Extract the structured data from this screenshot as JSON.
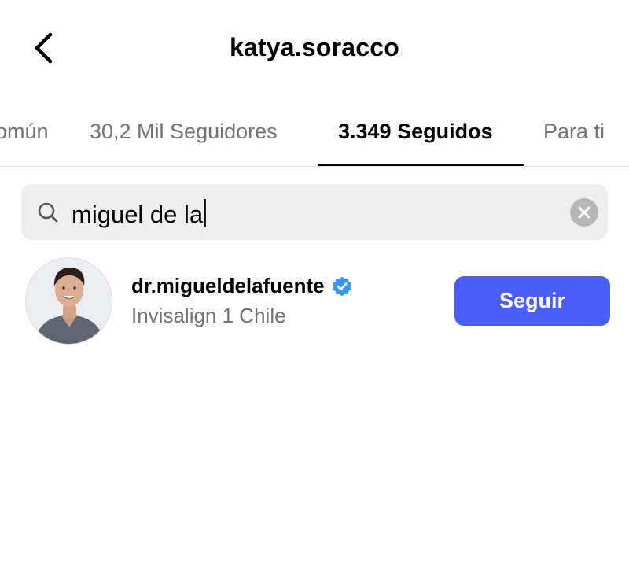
{
  "header": {
    "title": "katya.soracco",
    "back_icon": "chevron-left-icon"
  },
  "tabs": [
    {
      "label": "omún",
      "active": false
    },
    {
      "label": "30,2 Mil Seguidores",
      "active": false
    },
    {
      "label": "3.349 Seguidos",
      "active": true
    },
    {
      "label": "Para ti",
      "active": false
    }
  ],
  "search": {
    "value": "miguel de la",
    "search_icon": "search-icon",
    "clear_icon": "clear-icon"
  },
  "results": [
    {
      "username": "dr.migueldelafuente",
      "verified": true,
      "subtitle": "Invisalign 1 Chile",
      "button_label": "Seguir"
    }
  ],
  "colors": {
    "accent": "#4a5df9",
    "verified_badge": "#3897f0",
    "secondary_text": "#737373",
    "search_bg": "#efefef"
  }
}
